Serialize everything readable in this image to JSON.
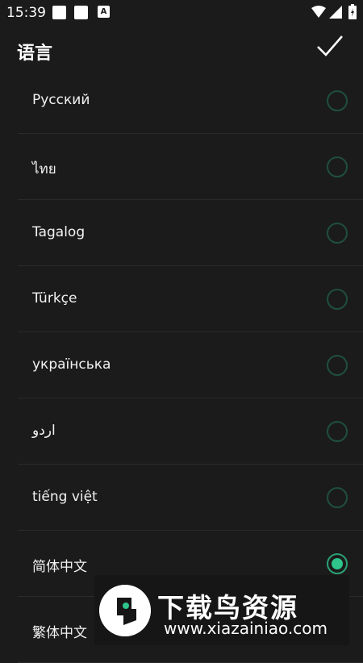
{
  "status_bar": {
    "time": "15:39",
    "notif_letter": "A"
  },
  "header": {
    "title": "语言"
  },
  "languages": [
    {
      "label": "Русский",
      "selected": false
    },
    {
      "label": "ไทย",
      "selected": false
    },
    {
      "label": "Tagalog",
      "selected": false
    },
    {
      "label": "Türkçe",
      "selected": false
    },
    {
      "label": "українська",
      "selected": false
    },
    {
      "label": "اردو",
      "selected": false
    },
    {
      "label": "tiếng việt",
      "selected": false
    },
    {
      "label": "简体中文",
      "selected": true
    },
    {
      "label": "繁体中文",
      "selected": false
    }
  ],
  "watermark": {
    "title": "下载鸟资源",
    "url": "www.xiazainiao.com"
  },
  "colors": {
    "background": "#1b1b1b",
    "accent": "#2ec48a",
    "radio_border": "#1f4f3e"
  }
}
